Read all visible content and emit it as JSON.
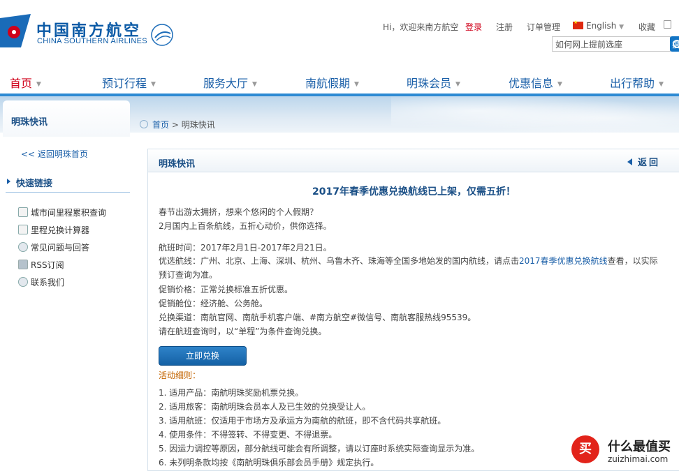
{
  "brand": {
    "name_cn": "中国南方航空",
    "name_en": "CHINA SOUTHERN AIRLINES",
    "colors": {
      "primary": "#0b5aa6",
      "accent": "#d0021b",
      "nav_bar": "#2d8ad3"
    }
  },
  "toplinks": {
    "greeting": "Hi，欢迎来南方航空",
    "login": "登录",
    "register": "注册",
    "orders": "订单管理",
    "language": "English",
    "favorite": "收藏",
    "search_placeholder": "如何网上提前选座",
    "search_button": "搜"
  },
  "nav": [
    {
      "label": "首页",
      "active": true
    },
    {
      "label": "预订行程"
    },
    {
      "label": "服务大厅"
    },
    {
      "label": "南航假期"
    },
    {
      "label": "明珠会员"
    },
    {
      "label": "优惠信息"
    },
    {
      "label": "出行帮助"
    }
  ],
  "breadcrumb": {
    "home": "首页",
    "sep": ">",
    "current": "明珠快讯"
  },
  "sidebar": {
    "title": "明珠快讯",
    "back_link": "<< 返回明珠首页",
    "quick_title": "快速链接",
    "links": [
      {
        "label": "城市间里程累积查询",
        "icon": "search-doc-icon"
      },
      {
        "label": "里程兑换计算器",
        "icon": "calculator-icon"
      },
      {
        "label": "常见问题与回答",
        "icon": "question-icon"
      },
      {
        "label": "RSS订阅",
        "icon": "rss-icon"
      },
      {
        "label": "联系我们",
        "icon": "contact-icon"
      }
    ]
  },
  "content": {
    "header_title": "明珠快讯",
    "back_label": "返回",
    "article_title": "2017年春季优惠兑换航线已上架，仅需五折！",
    "intro": [
      "春节出游太拥挤，想来个悠闲的个人假期？",
      "2月国内上百条航线，五折心动价，供你选择。"
    ],
    "flight_time": "航班时间：2017年2月1日-2017年2月21日。",
    "routes_prefix": "优选航线：广州、北京、上海、深圳、杭州、乌鲁木齐、珠海等全国多地始发的国内航线，请点击",
    "routes_link": "2017春季优惠兑换航线",
    "routes_suffix": "查看，以实际预订查询为准。",
    "price": "促销价格：正常兑换标准五折优惠。",
    "cabin": "促销舱位：经济舱、公务舱。",
    "channels": "兑换渠道：南航官网、南航手机客户端、#南方航空#微信号、南航客服热线95539。",
    "query_tip": "请在航班查询时，以“单程”为条件查询兑换。",
    "redeem_button": "立即兑换",
    "rules_title": "活动细则：",
    "rules": [
      "1. 适用产品：南航明珠奖励机票兑换。",
      "2. 适用旅客：南航明珠会员本人及已生效的兑换受让人。",
      "3. 适用航班：仅适用于市场方及承运方为南航的航班，即不含代码共享航班。",
      "4. 使用条件：不得签转、不得变更、不得退票。",
      "5. 因运力调控等原因，部分航线可能会有所调整，请以订座时系统实际查询显示为准。",
      "6. 未列明条款均按《南航明珠俱乐部会员手册》规定执行。"
    ]
  },
  "watermark": {
    "badge": "买",
    "cn": "什么最值买",
    "en": "zuizhimai.com"
  }
}
